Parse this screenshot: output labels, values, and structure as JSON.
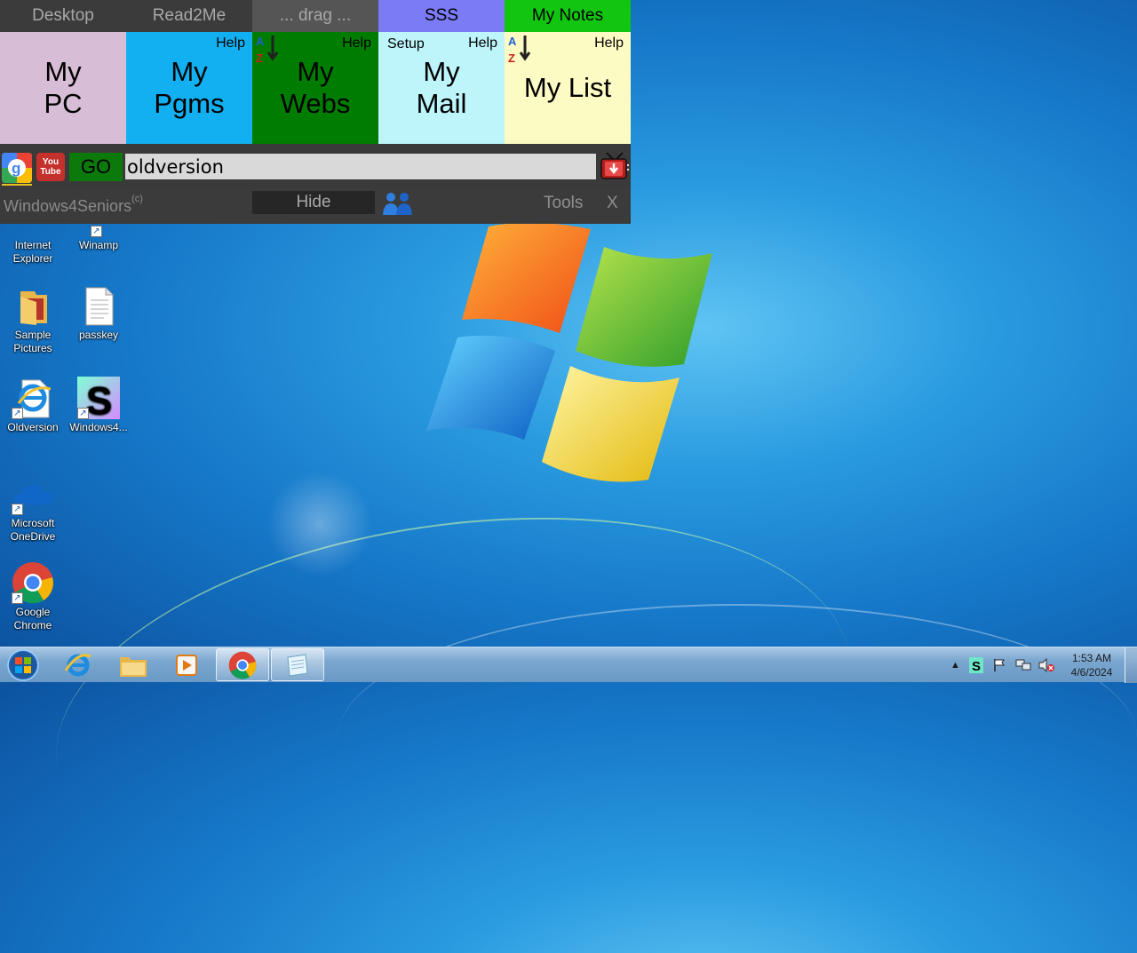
{
  "panel": {
    "tabs": [
      {
        "label": "Desktop",
        "bg": "#3b3b3b",
        "fg": "#a8a8a8"
      },
      {
        "label": "Read2Me",
        "bg": "#3b3b3b",
        "fg": "#a8a8a8"
      },
      {
        "label": "... drag ...",
        "bg": "#555555",
        "fg": "#a8a8a8"
      },
      {
        "label": "SSS",
        "bg": "#7b7bf5",
        "fg": "#000000"
      },
      {
        "label": "My Notes",
        "bg": "#11c511",
        "fg": "#000000"
      }
    ],
    "tiles": [
      {
        "line1": "My",
        "line2": "PC",
        "bg": "#d8bdd6"
      },
      {
        "line1": "My",
        "line2": "Pgms",
        "help": "Help",
        "bg": "#12b0f0"
      },
      {
        "line1": "My",
        "line2": "Webs",
        "help": "Help",
        "bg": "#007c00"
      },
      {
        "line1": "My",
        "line2": "Mail",
        "help": "Help",
        "setup": "Setup",
        "bg": "#bdf5fb"
      },
      {
        "line1": "My List",
        "help": "Help",
        "bg": "#fdfbc4"
      }
    ],
    "search": {
      "go_label": "GO",
      "value": "oldversion",
      "youtube_label_1": "You",
      "youtube_label_2": "Tube"
    },
    "bottom": {
      "brand": "Windows4Seniors",
      "brand_sup": "(c)",
      "hide_label": "Hide",
      "tools_label": "Tools",
      "close_label": "X"
    }
  },
  "desktop_icons": [
    {
      "line1": "Internet",
      "line2": "Explorer"
    },
    {
      "line1": "Winamp",
      "line2": ""
    },
    {
      "line1": "Sample",
      "line2": "Pictures"
    },
    {
      "line1": "passkey",
      "line2": ""
    },
    {
      "line1": "Oldversion",
      "line2": ""
    },
    {
      "line1": "Windows4...",
      "line2": ""
    },
    {
      "line1": "Microsoft",
      "line2": "OneDrive"
    },
    {
      "line1": "Google",
      "line2": "Chrome"
    }
  ],
  "taskbar": {
    "clock_time": "1:53 AM",
    "clock_date": "4/6/2024"
  }
}
